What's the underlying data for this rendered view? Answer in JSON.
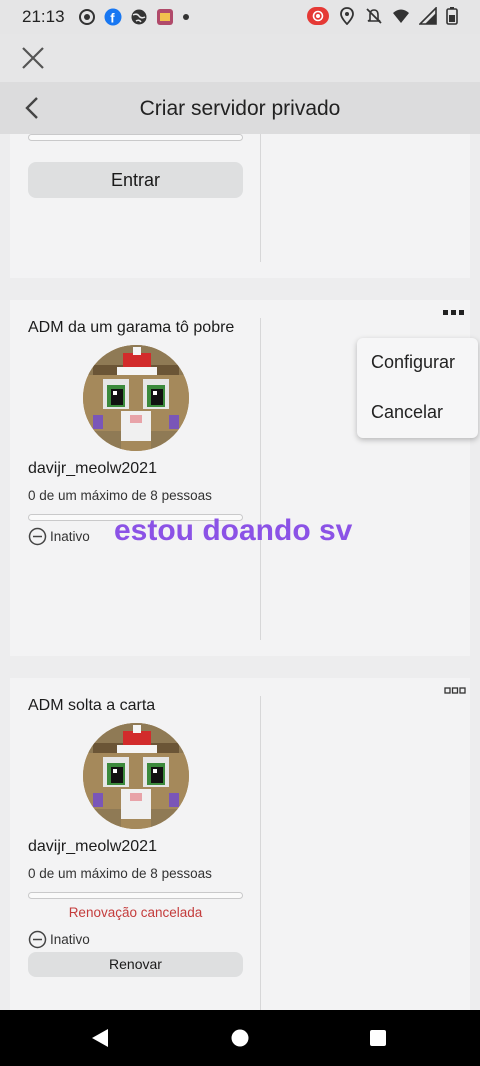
{
  "status_bar": {
    "time": "21:13",
    "left_icons": [
      "settings-notification-icon",
      "facebook-icon",
      "globe-icon",
      "app-icon",
      "dot-icon"
    ],
    "right_icons": [
      "record-icon",
      "location-icon",
      "mute-icon",
      "wifi-icon",
      "signal-icon",
      "battery-icon"
    ]
  },
  "header": {
    "close_icon": "close-icon",
    "back_icon": "back-arrow-icon",
    "title": "Criar servidor privado"
  },
  "top_card": {
    "join_label": "Entrar"
  },
  "servers": [
    {
      "name": "ADM da um garama tô pobre",
      "owner": "davijr_meolw2021",
      "capacity": "0 de um máximo de 8 pessoas",
      "progress_fraction": 0,
      "status": "Inativo"
    },
    {
      "name": "ADM solta a carta",
      "owner": "davijr_meolw2021",
      "capacity": "0 de um máximo de 8 pessoas",
      "progress_fraction": 0,
      "renewal_note": "Renovação cancelada",
      "status": "Inativo",
      "renew_label": "Renovar"
    }
  ],
  "menu": {
    "items": [
      "Configurar",
      "Cancelar"
    ]
  },
  "overlay": {
    "text": "estou doando sv",
    "color": "#8b52e6"
  },
  "colors": {
    "accent_red": "#c43c3c",
    "nav_background": "#000000"
  }
}
